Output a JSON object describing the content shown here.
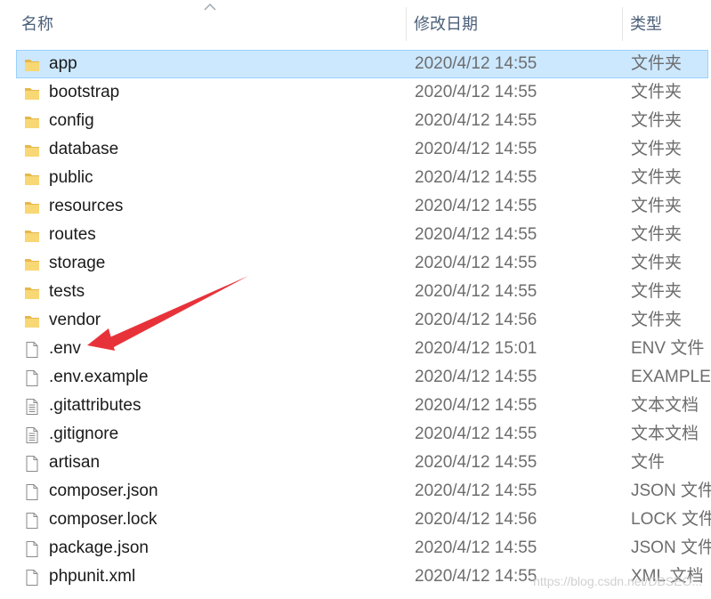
{
  "columns": {
    "name": "名称",
    "date": "修改日期",
    "type": "类型"
  },
  "colors": {
    "folder": "#f8d775",
    "folder_dark": "#e6b84a",
    "selected_bg": "#cce8ff",
    "arrow": "#e8323a"
  },
  "files": [
    {
      "name": "app",
      "date": "2020/4/12 14:55",
      "type": "文件夹",
      "icon": "folder-icon",
      "selected": true
    },
    {
      "name": "bootstrap",
      "date": "2020/4/12 14:55",
      "type": "文件夹",
      "icon": "folder-icon"
    },
    {
      "name": "config",
      "date": "2020/4/12 14:55",
      "type": "文件夹",
      "icon": "folder-icon"
    },
    {
      "name": "database",
      "date": "2020/4/12 14:55",
      "type": "文件夹",
      "icon": "folder-icon"
    },
    {
      "name": "public",
      "date": "2020/4/12 14:55",
      "type": "文件夹",
      "icon": "folder-icon"
    },
    {
      "name": "resources",
      "date": "2020/4/12 14:55",
      "type": "文件夹",
      "icon": "folder-icon"
    },
    {
      "name": "routes",
      "date": "2020/4/12 14:55",
      "type": "文件夹",
      "icon": "folder-icon"
    },
    {
      "name": "storage",
      "date": "2020/4/12 14:55",
      "type": "文件夹",
      "icon": "folder-icon"
    },
    {
      "name": "tests",
      "date": "2020/4/12 14:55",
      "type": "文件夹",
      "icon": "folder-icon"
    },
    {
      "name": "vendor",
      "date": "2020/4/12 14:56",
      "type": "文件夹",
      "icon": "folder-icon"
    },
    {
      "name": ".env",
      "date": "2020/4/12 15:01",
      "type": "ENV 文件",
      "icon": "file-icon"
    },
    {
      "name": ".env.example",
      "date": "2020/4/12 14:55",
      "type": "EXAMPLE",
      "icon": "file-icon"
    },
    {
      "name": ".gitattributes",
      "date": "2020/4/12 14:55",
      "type": "文本文档",
      "icon": "text-file-icon"
    },
    {
      "name": ".gitignore",
      "date": "2020/4/12 14:55",
      "type": "文本文档",
      "icon": "text-file-icon"
    },
    {
      "name": "artisan",
      "date": "2020/4/12 14:55",
      "type": "文件",
      "icon": "file-icon"
    },
    {
      "name": "composer.json",
      "date": "2020/4/12 14:55",
      "type": "JSON 文件",
      "icon": "file-icon"
    },
    {
      "name": "composer.lock",
      "date": "2020/4/12 14:56",
      "type": "LOCK 文件",
      "icon": "file-icon"
    },
    {
      "name": "package.json",
      "date": "2020/4/12 14:55",
      "type": "JSON 文件",
      "icon": "file-icon"
    },
    {
      "name": "phpunit.xml",
      "date": "2020/4/12 14:55",
      "type": "XML 文档",
      "icon": "file-icon"
    }
  ],
  "watermark": "https://blog.csdn.net/DBSEO..."
}
